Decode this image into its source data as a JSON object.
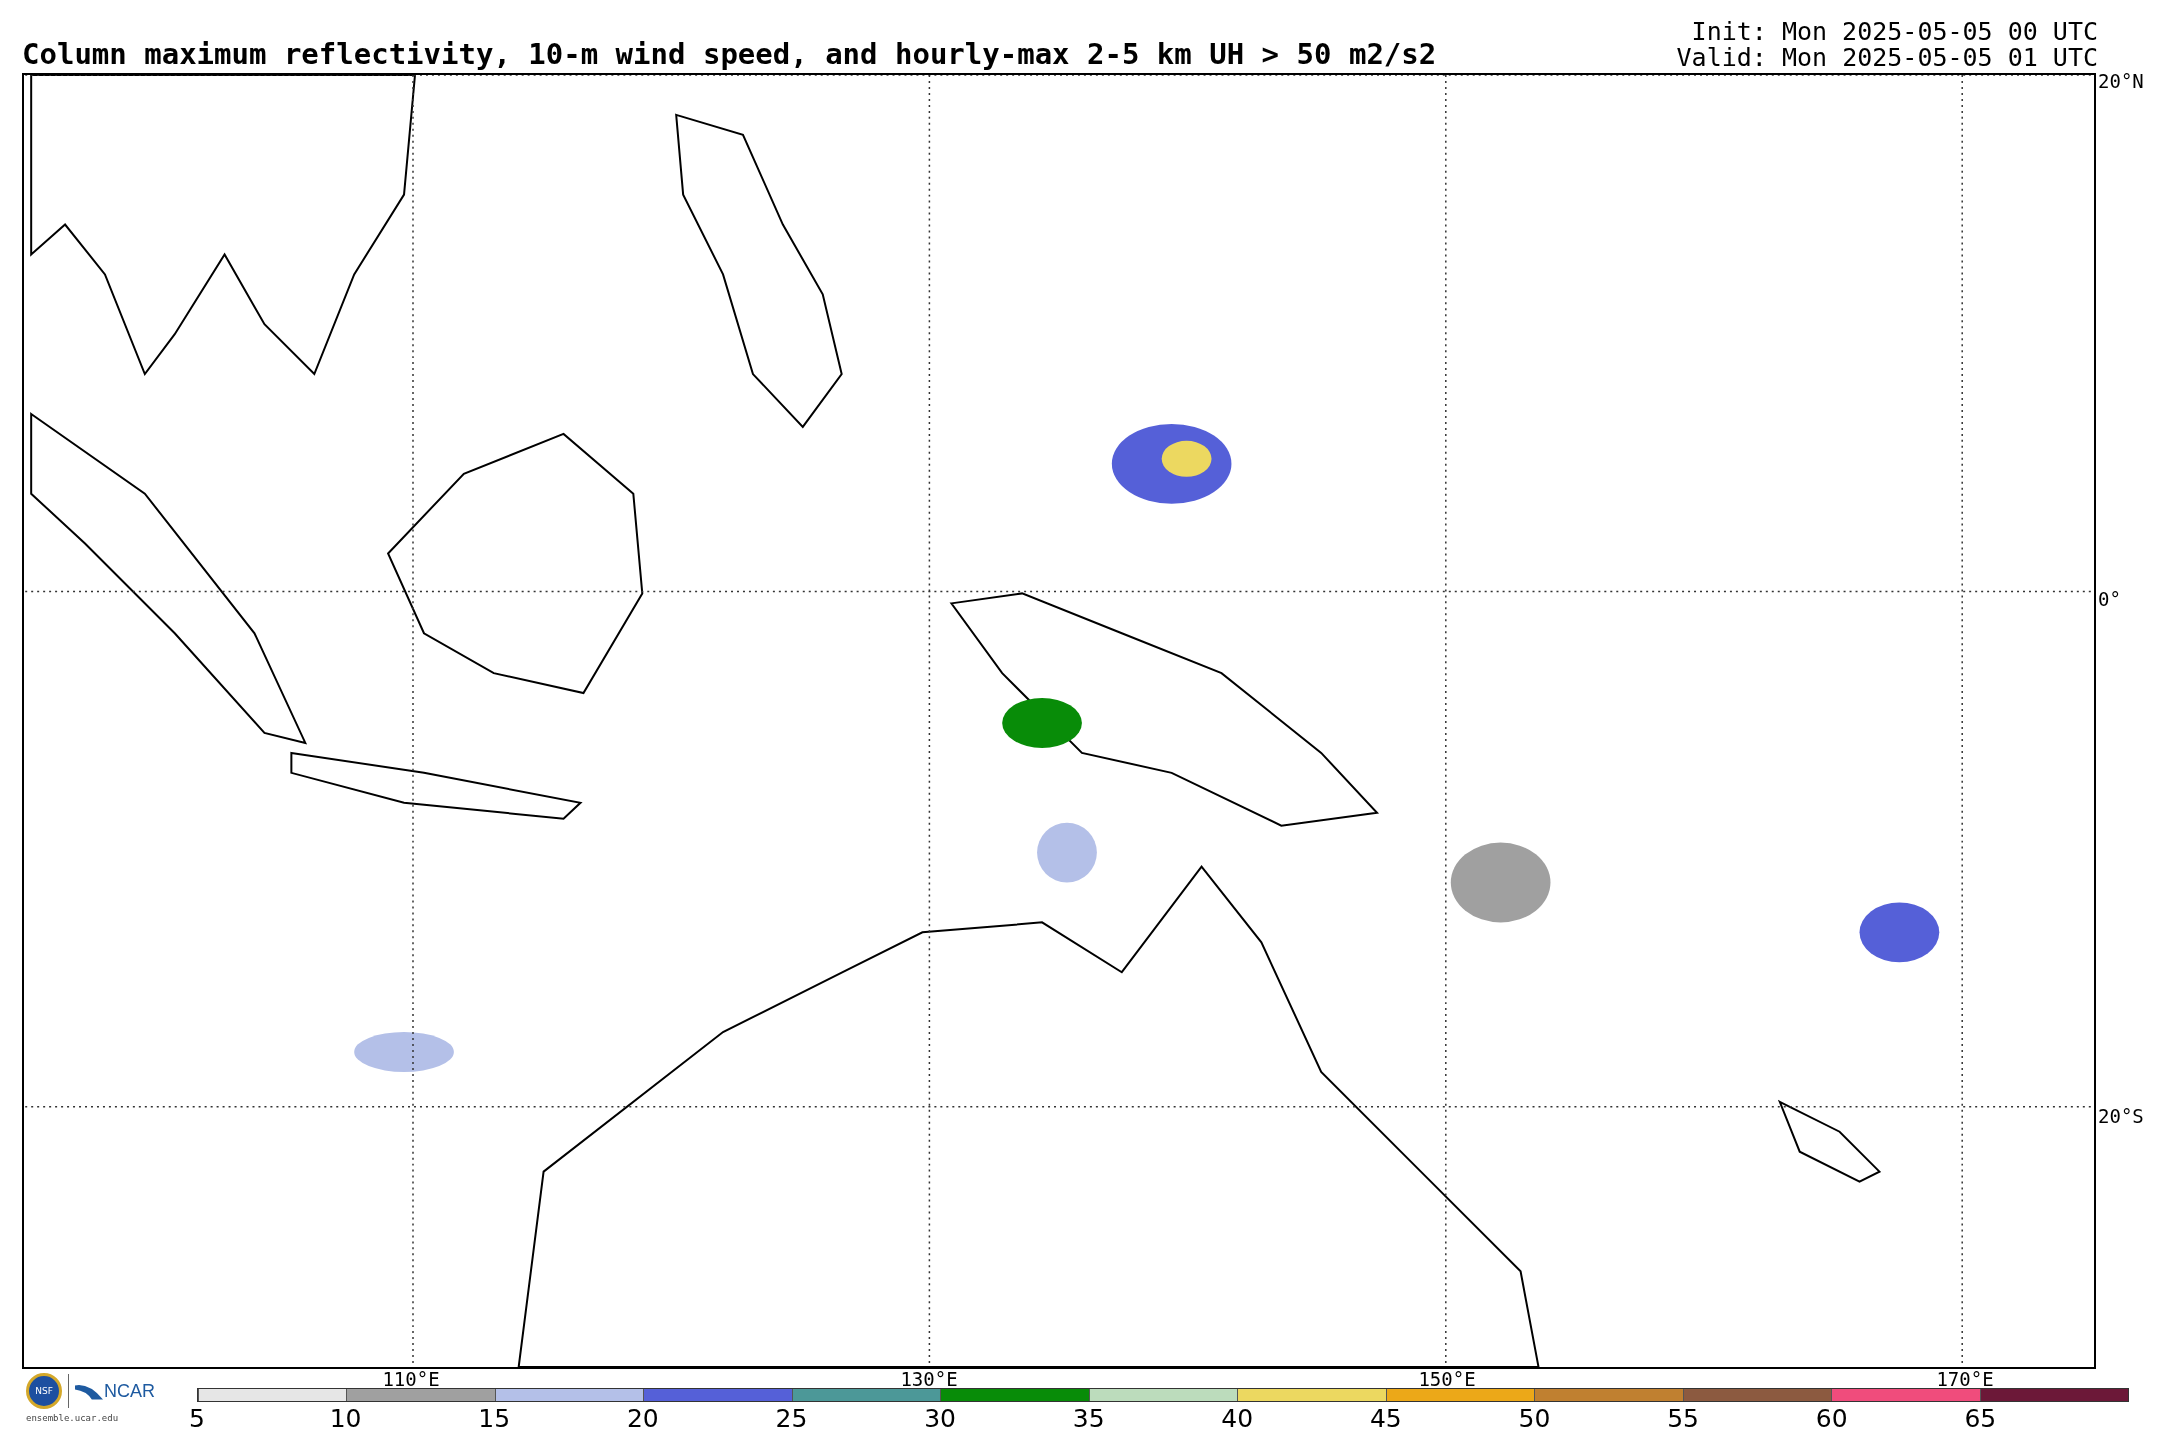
{
  "title": "Column maximum reflectivity, 10-m wind speed, and hourly-max 2-5 km UH > 50 m2/s2",
  "init": "Init: Mon 2025-05-05 00 UTC",
  "valid": "Valid: Mon 2025-05-05 01 UTC",
  "map": {
    "lat_labels": [
      "20°N",
      "0°",
      "20°S"
    ],
    "lon_labels": [
      "110°E",
      "130°E",
      "150°E",
      "170°E"
    ]
  },
  "logos": {
    "nsf": "NSF",
    "ncar": "NCAR",
    "site": "ensemble.ucar.edu"
  },
  "colorbar": {
    "segments": [
      {
        "color": "#e6e6e6"
      },
      {
        "color": "#a0a0a0"
      },
      {
        "color": "#b4c0e8"
      },
      {
        "color": "#5560d8"
      },
      {
        "color": "#4c9898"
      },
      {
        "color": "#088c08"
      },
      {
        "color": "#bcdcbc"
      },
      {
        "color": "#ecd860"
      },
      {
        "color": "#eca818"
      },
      {
        "color": "#c08030"
      },
      {
        "color": "#8c5a40"
      },
      {
        "color": "#f04c7c"
      },
      {
        "color": "#6c1838"
      }
    ],
    "labels": [
      "5",
      "10",
      "15",
      "20",
      "25",
      "30",
      "35",
      "40",
      "45",
      "50",
      "55",
      "60",
      "65"
    ]
  }
}
